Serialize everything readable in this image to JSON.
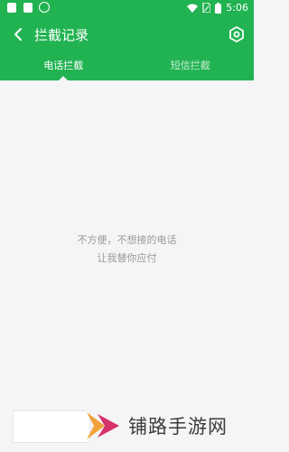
{
  "status_bar": {
    "time": "5:06"
  },
  "header": {
    "title": "拦截记录"
  },
  "tabs": [
    {
      "label": "电话拦截",
      "active": true
    },
    {
      "label": "短信拦截",
      "active": false
    }
  ],
  "empty_state": {
    "line1": "不方便，不想接的电话",
    "line2": "让我替你应付"
  },
  "watermark": {
    "text": "铺路手游网"
  },
  "colors": {
    "brand": "#21b352",
    "background": "#f5f5f7",
    "empty_text": "#999999"
  }
}
